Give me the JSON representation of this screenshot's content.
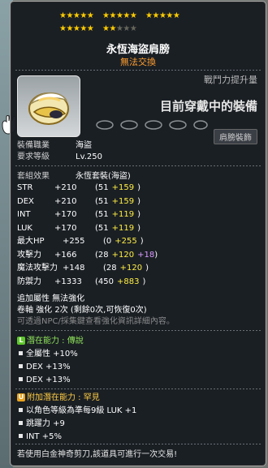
{
  "item": {
    "stars_row1": [
      "★★★★★",
      "★★★★★",
      "★★★★★"
    ],
    "stars_row2": [
      "★★★★★",
      "★★"
    ],
    "stars_row2_dim": "★★★",
    "name": "永恆海盜肩膀",
    "trade_status": "無法交換",
    "combat_power_label": "戰鬥力提升量",
    "current_label": "目前穿戴中的裝備",
    "slot_button": "肩膀裝飾"
  },
  "requirements": [
    {
      "label": "裝備職業",
      "value": "海盜"
    },
    {
      "label": "要求等級",
      "value": "Lv.250"
    }
  ],
  "set_effect": {
    "label": "套組效果",
    "value": "永恆套裝(海盜)"
  },
  "stats": [
    {
      "name": "STR",
      "total": "+210",
      "base": "(51",
      "bonus": "+159",
      "extra": "",
      "close": ")"
    },
    {
      "name": "DEX",
      "total": "+210",
      "base": "(51",
      "bonus": "+159",
      "extra": "",
      "close": ")"
    },
    {
      "name": "INT",
      "total": "+170",
      "base": "(51",
      "bonus": "+119",
      "extra": "",
      "close": ")"
    },
    {
      "name": "LUK",
      "total": "+170",
      "base": "(51",
      "bonus": "+119",
      "extra": "",
      "close": ")"
    },
    {
      "name": "最大HP",
      "total": "+255",
      "base": "(0",
      "bonus": "+255",
      "extra": "",
      "close": ")"
    },
    {
      "name": "攻擊力",
      "total": "+166",
      "base": "(28",
      "bonus": "+120",
      "extra": "+18",
      "close": ")"
    },
    {
      "name": "魔法攻擊力",
      "total": "+148",
      "base": "(28",
      "bonus": "+120",
      "extra": "",
      "close": ")"
    },
    {
      "name": "防禦力",
      "total": "+1333",
      "base": "(450",
      "bonus": "+883",
      "extra": "",
      "close": ")"
    }
  ],
  "extra_info": {
    "added_attribute": "追加屬性 無法強化",
    "scroll": "卷軸 強化 2次 (剩餘0次,可恢復0次)",
    "npc_note": "可透過NPC/採集鍵查看強化資訊詳細內容。"
  },
  "potential": {
    "badge": "L",
    "title": "潛在能力 : 傳說",
    "lines": [
      "全屬性 +10%",
      "DEX +13%",
      "DEX +13%"
    ]
  },
  "additional_potential": {
    "badge": "U",
    "title": "附加潛在能力 : 罕見",
    "lines": [
      "以角色等級為準每9級 LUK +1",
      "跳躍力 +9",
      "INT +5%"
    ]
  },
  "footer": "若使用白金神奇剪刀,該道具可進行一次交易!",
  "colors": {
    "legendary": "#8fe35a",
    "unique": "#ffcc44",
    "star": "#ffcc00",
    "bonus": "#ffee44"
  }
}
